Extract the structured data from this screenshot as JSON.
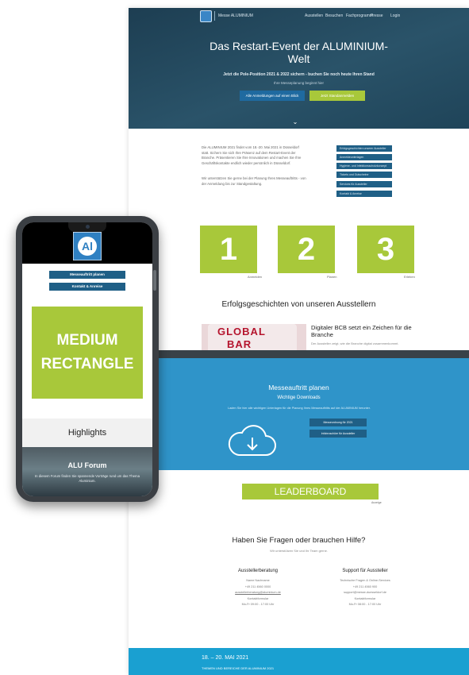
{
  "desktop": {
    "nav": {
      "brand": "Messe ALUMINIUM",
      "items": [
        "Ausstellen",
        "Besuchen",
        "Fachprogramm",
        "Presse",
        "Login"
      ]
    },
    "hero": {
      "title": "Das Restart-Event der ALUMINIUM-Welt",
      "subtitle": "Jetzt die Pole-Position 2021 & 2022 sichern - buchen Sie noch heute Ihren Stand",
      "small": "Ihre Messeplanung beginnt hier",
      "btn1": "Alle Anmeldungen auf einen Blick",
      "btn2": "Jetzt Standanmelden"
    },
    "intro": {
      "p1": "Die ALUMINIUM 2021 findet vom 18.-20. Mai 2021 in Düsseldorf statt. Sichern Sie sich Ihre Präsenz auf dem Restart-Event der Branche. Präsentieren Sie Ihre Innovationen und machen Sie Ihre Geschäftskontakte endlich wieder persönlich in Düsseldorf.",
      "p2": "Wir unterstützen Sie gerne bei der Planung Ihres Messeauftritts - von der Anmeldung bis zur Standgestaltung."
    },
    "side_buttons": [
      "Erfolgsgeschichten unserer Aussteller",
      "Anmeldeunterlagen",
      "Hygiene- und Infektionsschutzkonzept",
      "Tickets und Gutscheine",
      "Services für Aussteller",
      "Kontakt & Anreise"
    ],
    "tiles": [
      {
        "num": "1",
        "cap": "Anmelden"
      },
      {
        "num": "2",
        "cap": "Planen"
      },
      {
        "num": "3",
        "cap": "Erleben"
      }
    ],
    "success_title": "Erfolgsgeschichten von unseren Ausstellern",
    "story": {
      "img_line1": "GLOBAL",
      "img_line2": "BAR",
      "title": "Digitaler BCB setzt ein Zeichen für die Branche",
      "text": "Der Aussteller zeigt, wie die Branche digital zusammenkommt."
    },
    "plan": {
      "title": "Messeauftritt planen",
      "subtitle": "Wichtige Downloads",
      "text": "Laden Sie hier alle wichtigen Unterlagen für die Planung Ihres Messeauftritts auf der ALUMINIUM herunter.",
      "btn1": "Messeordnung für 2021",
      "btn2": "Infobroschüre für Aussteller"
    },
    "leaderboard": "LEADERBOARD",
    "leaderboard_cap": "Anzeige",
    "help": {
      "title": "Haben Sie Fragen oder brauchen Hilfe?",
      "sub": "Wir unterstützen Sie und Ihr Team gerne.",
      "left": {
        "head": "Ausstellerberatung",
        "lines": [
          "Name Nachname",
          "+49 211 4560 0000",
          "ausstellerberatung@aluminium.de",
          "Kontaktformular",
          "Mo-Fr 09:00 - 17:00 Uhr"
        ]
      },
      "right": {
        "head": "Support für Aussteller",
        "lines": [
          "Technische Fragen & Online-Services",
          "+49 211 4560 900",
          "support@messe-duesseldorf.de",
          "Kontaktformular",
          "Mo-Fr 08:00 - 17:00 Uhr"
        ]
      }
    },
    "footer": {
      "date": "18. – 20. MAI 2021",
      "line": "THEMEN UND BEREICHE DER ALUMINIUM 2021"
    }
  },
  "phone": {
    "btn1": "Messeauftritt planen",
    "btn2": "Kontakt & Anreise",
    "ad": [
      "MEDIUM",
      "RECTANGLE"
    ],
    "highlights": "Highlights",
    "alu_title": "ALU Forum",
    "alu_text": "In diesem Forum finden Sie spannende Vorträge rund um das Thema Aluminium."
  },
  "colors": {
    "navy": "#1d3e52",
    "green": "#a8c83a",
    "blue": "#2f94c9",
    "button": "#1f5f86"
  }
}
